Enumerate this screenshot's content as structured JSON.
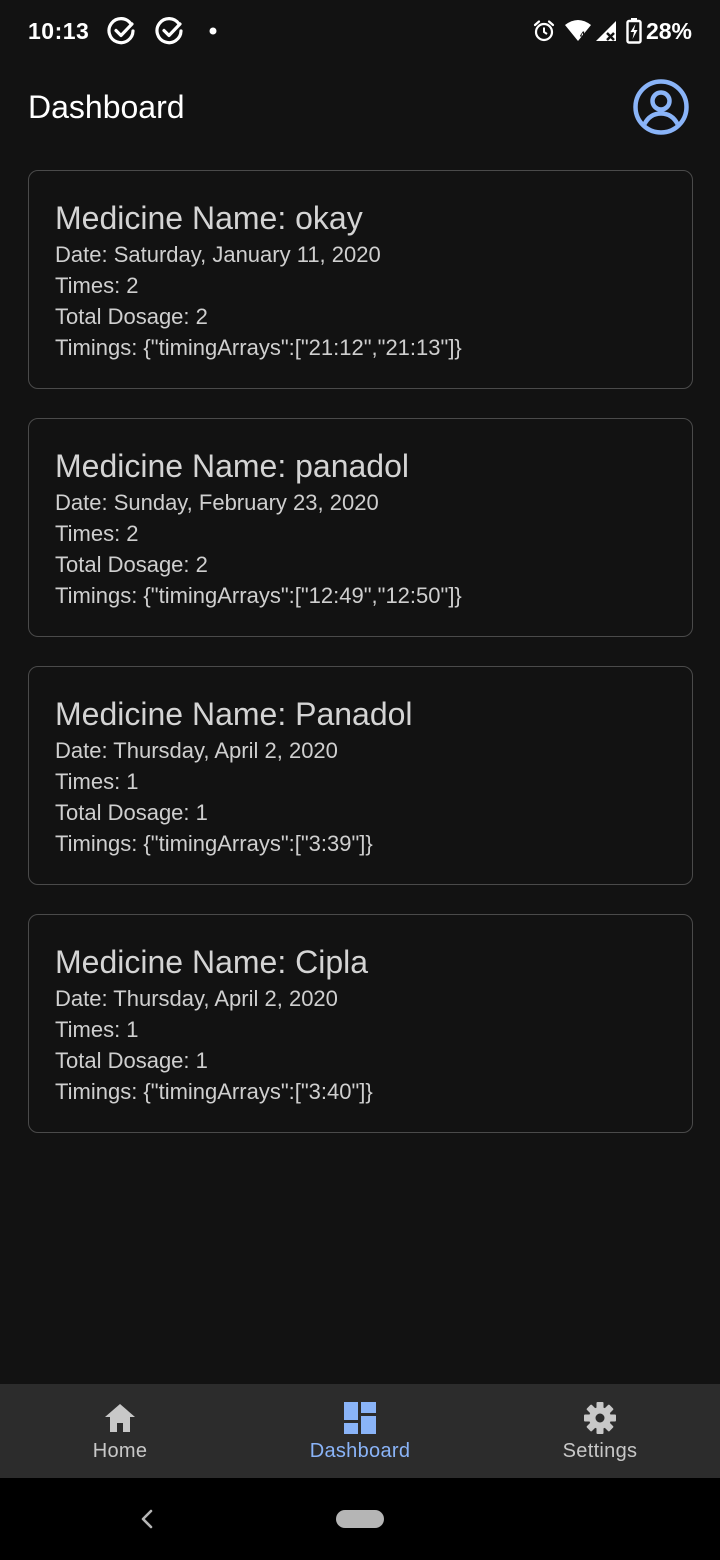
{
  "status_bar": {
    "time": "10:13",
    "battery": "28%",
    "left_icons": [
      "check-circle-icon",
      "check-circle-icon",
      "dot-icon"
    ],
    "right_icons": [
      "alarm-icon",
      "wifi-icon",
      "signal-icon",
      "battery-charging-icon"
    ]
  },
  "header": {
    "title": "Dashboard",
    "profile_icon": "account-circle-icon"
  },
  "cards": [
    {
      "title": "Medicine Name: okay",
      "date": "Date: Saturday, January 11, 2020",
      "times": "Times: 2",
      "dosage": "Total Dosage: 2",
      "timings": "Timings: {\"timingArrays\":[\"21:12\",\"21:13\"]}"
    },
    {
      "title": "Medicine Name: panadol",
      "date": "Date: Sunday, February 23, 2020",
      "times": "Times: 2",
      "dosage": "Total Dosage: 2",
      "timings": "Timings: {\"timingArrays\":[\"12:49\",\"12:50\"]}"
    },
    {
      "title": "Medicine Name: Panadol",
      "date": "Date: Thursday, April 2, 2020",
      "times": "Times: 1",
      "dosage": "Total Dosage: 1",
      "timings": "Timings: {\"timingArrays\":[\"3:39\"]}"
    },
    {
      "title": "Medicine Name: Cipla",
      "date": "Date: Thursday, April 2, 2020",
      "times": "Times: 1",
      "dosage": "Total Dosage: 1",
      "timings": "Timings: {\"timingArrays\":[\"3:40\"]}"
    }
  ],
  "bottom_nav": {
    "items": [
      {
        "label": "Home",
        "icon": "home-icon",
        "active": false
      },
      {
        "label": "Dashboard",
        "icon": "dashboard-icon",
        "active": true
      },
      {
        "label": "Settings",
        "icon": "gear-icon",
        "active": false
      }
    ]
  },
  "colors": {
    "background": "#121212",
    "accent": "#8ab4f8",
    "card_border": "#4a4a4a",
    "nav_background": "#2c2c2c"
  }
}
